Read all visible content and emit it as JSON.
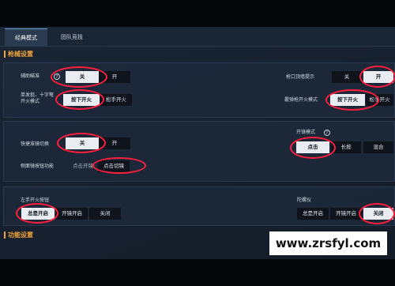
{
  "tabs": [
    {
      "label": "经典模式",
      "active": true
    },
    {
      "label": "团队竞技",
      "active": false
    }
  ],
  "sections": {
    "weapon": "枪械设置",
    "function": "功能设置"
  },
  "rows": {
    "assist_aim": {
      "label": "辅助瞄准",
      "options": [
        "关",
        "开"
      ],
      "selected": "关"
    },
    "fire_single": {
      "label": "单发狙、十字弩开火模式",
      "options": [
        "按下开火",
        "松手开火"
      ],
      "selected": "按下开火"
    },
    "muzzle_hint": {
      "label": "枪口顶墙提示",
      "options": [
        "关",
        "开"
      ],
      "selected": "开"
    },
    "shotgun_fire": {
      "label": "霰弹枪开火模式",
      "options": [
        "按下开火",
        "松手开火"
      ],
      "selected": "按下开火"
    },
    "quick_scope": {
      "label": "快捷准镜切换",
      "options": [
        "关",
        "开"
      ],
      "selected": "关"
    },
    "side_scope": {
      "label": "侧面镜按钮功能",
      "options": [
        "点击开镜",
        "点击切镜"
      ],
      "selected": "点击切镜"
    },
    "scope_mode": {
      "label": "开镜模式",
      "options": [
        "点击",
        "长按",
        "混合"
      ],
      "selected": "点击"
    },
    "left_fire": {
      "label": "左手开火按钮",
      "options": [
        "总是开启",
        "开镜开启",
        "关闭"
      ],
      "selected": "总是开启"
    },
    "gyro": {
      "label": "陀螺仪",
      "options": [
        "总是开启",
        "开镜开启",
        "关闭"
      ],
      "selected": "关闭"
    }
  },
  "help_glyph": "?",
  "highlight_color": "#ff1f3d",
  "watermark": "www.zrsfyl.com"
}
